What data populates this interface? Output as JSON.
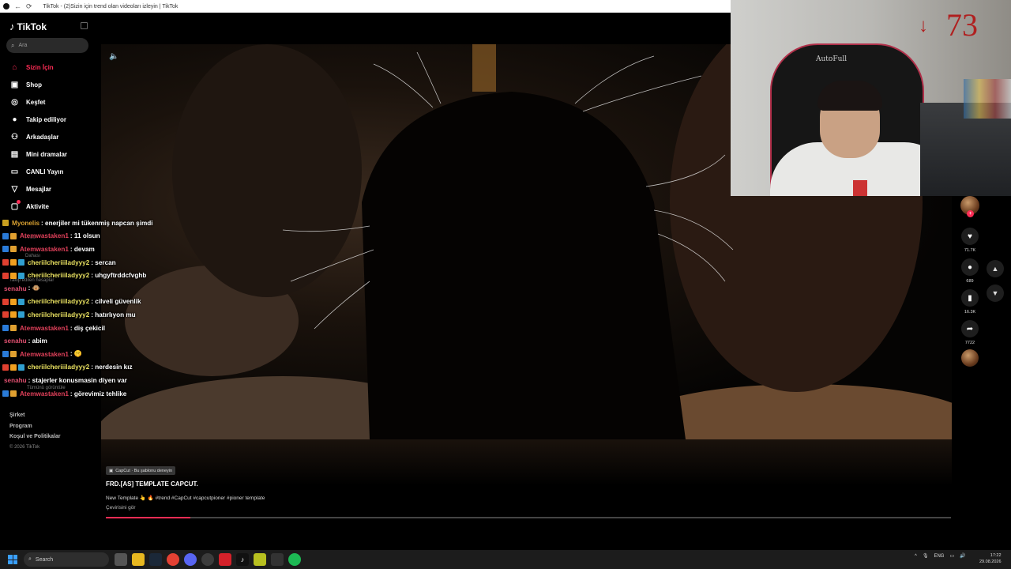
{
  "browser": {
    "tab_title": "TikTok - (2)Sizin için trend olan videoları izleyin | TikTok"
  },
  "sidebar": {
    "logo": "TikTok",
    "search_placeholder": "Ara",
    "items": [
      {
        "label": "Sizin İçin",
        "icon": "home-icon",
        "active": true
      },
      {
        "label": "Shop",
        "icon": "shop-bag-icon"
      },
      {
        "label": "Keşfet",
        "icon": "compass-icon"
      },
      {
        "label": "Takip ediliyor",
        "icon": "following-avatar-icon"
      },
      {
        "label": "Arkadaşlar",
        "icon": "friends-icon"
      },
      {
        "label": "Mini dramalar",
        "icon": "mini-drama-icon"
      },
      {
        "label": "CANLI Yayın",
        "icon": "live-tv-icon"
      },
      {
        "label": "Mesajlar",
        "icon": "send-icon"
      },
      {
        "label": "Aktivite",
        "icon": "inbox-icon"
      }
    ],
    "ghost_items": [
      "Profil",
      "Dahası",
      "Takip edilen hesaplar",
      "Tümünü görüntüle"
    ],
    "footer": [
      "Şirket",
      "Program",
      "Koşul ve Politikalar"
    ],
    "copyright": "© 2026 TikTok"
  },
  "video": {
    "capcut_tag": "CapCut · Bu şablonu deneyin",
    "title": "FRD.[AS] TEMPLATE CAPCUT.",
    "description": "New Template 👆 🔥 #trend #CapCut #capcutpioner #pioner template",
    "translate": "Çevirisini gör",
    "progress": 0.1
  },
  "actions": {
    "likes": "71.7K",
    "comments": "689",
    "saves": "16.3K",
    "shares": "7722"
  },
  "webcam": {
    "counter": "73",
    "chair_brand": "AutoFull"
  },
  "chat": [
    {
      "user": "Myonelis",
      "text": ": enerjiler mi tükenmiş napcan şimdi",
      "color": "#d8a030",
      "badges": [
        "#c9a020"
      ]
    },
    {
      "user": "Atemwastaken1",
      "text": ": 11 olsun",
      "color": "#e0405a",
      "badges": [
        "#2a7bd8",
        "#e0a030"
      ]
    },
    {
      "user": "Atemwastaken1",
      "text": ": devam",
      "color": "#e0405a",
      "badges": [
        "#2a7bd8",
        "#e0a030"
      ]
    },
    {
      "user": "cheriilcheriiiladyyy2",
      "text": ": sercan",
      "color": "#e8e060",
      "badges": [
        "#e04030",
        "#f0a020",
        "#30a0d0"
      ]
    },
    {
      "user": "cheriilcheriiiladyyy2",
      "text": ": uhgyftrddcfvghb",
      "color": "#e8e060",
      "badges": [
        "#e04030",
        "#f0a020",
        "#30a0d0"
      ]
    },
    {
      "user": "senahu",
      "text": ": 🐵",
      "color": "#e05070",
      "badges": []
    },
    {
      "user": "cheriilcheriiiladyyy2",
      "text": ": cilveli güvenlik",
      "color": "#e8e060",
      "badges": [
        "#e04030",
        "#f0a020",
        "#30a0d0"
      ]
    },
    {
      "user": "cheriilcheriiiladyyy2",
      "text": ": hatırlıyon mu",
      "color": "#e8e060",
      "badges": [
        "#e04030",
        "#f0a020",
        "#30a0d0"
      ]
    },
    {
      "user": "Atemwastaken1",
      "text": ": diş çekicil",
      "color": "#e0405a",
      "badges": [
        "#2a7bd8",
        "#e0a030"
      ]
    },
    {
      "user": "senahu",
      "text": ": abim",
      "color": "#e05070",
      "badges": []
    },
    {
      "user": "Atemwastaken1",
      "text": ": 🤫",
      "color": "#e0405a",
      "badges": [
        "#2a7bd8",
        "#e0a030"
      ]
    },
    {
      "user": "cheriilcheriiiladyyy2",
      "text": ": nerdesin kız",
      "color": "#e8e060",
      "badges": [
        "#e04030",
        "#f0a020",
        "#30a0d0"
      ]
    },
    {
      "user": "senahu",
      "text": ": stajerler konusmasin diyen var",
      "color": "#e05070",
      "badges": []
    },
    {
      "user": "Atemwastaken1",
      "text": ": görevimiz tehlike",
      "color": "#e0405a",
      "badges": [
        "#2a7bd8",
        "#e0a030"
      ]
    }
  ],
  "taskbar": {
    "search": "Search",
    "lang": "ENG",
    "time": "17:22",
    "date": "29.08.2026"
  }
}
